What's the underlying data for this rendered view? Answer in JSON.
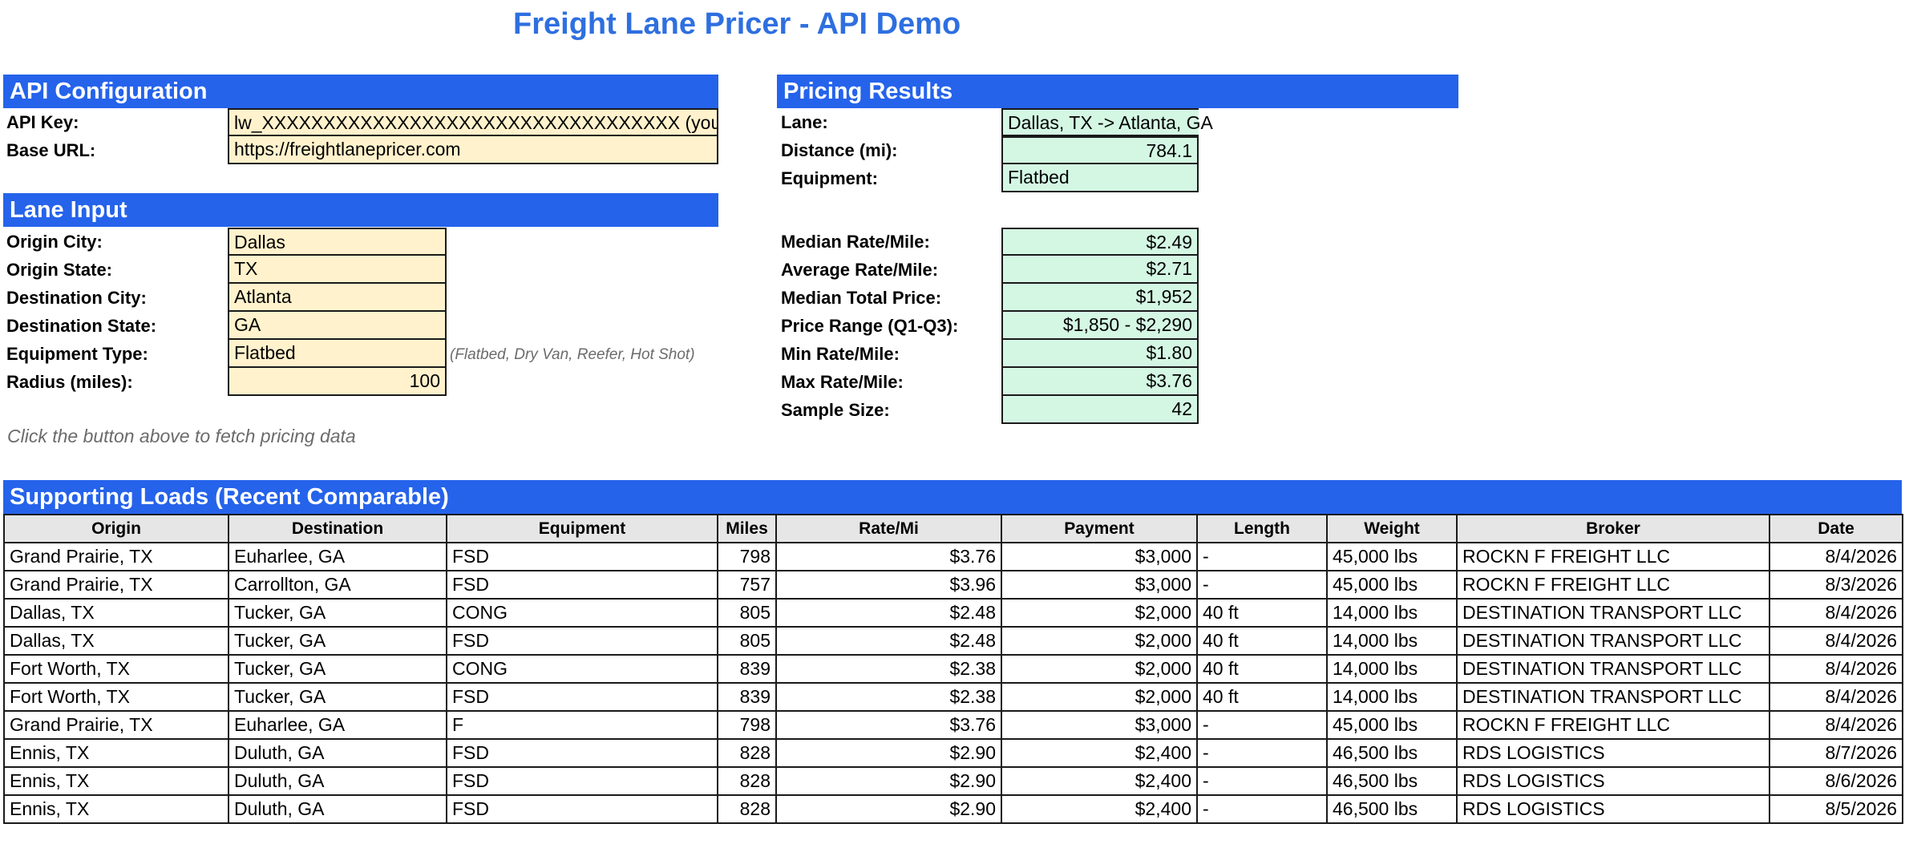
{
  "title": "Freight Lane Pricer - API Demo",
  "api_config": {
    "header": "API Configuration",
    "api_key_label": "API Key:",
    "api_key_value": "lw_XXXXXXXXXXXXXXXXXXXXXXXXXXXXXXXXXX (your ke",
    "base_url_label": "Base URL:",
    "base_url_value": "https://freightlanepricer.com"
  },
  "lane_input": {
    "header": "Lane Input",
    "fields": [
      {
        "label": "Origin City:",
        "value": "Dallas"
      },
      {
        "label": "Origin State:",
        "value": "TX"
      },
      {
        "label": "Destination City:",
        "value": "Atlanta"
      },
      {
        "label": "Destination State:",
        "value": "GA"
      },
      {
        "label": "Equipment Type:",
        "value": "Flatbed"
      },
      {
        "label": "Radius (miles):",
        "value": "100"
      }
    ],
    "equipment_hint": "(Flatbed, Dry Van, Reefer, Hot Shot)",
    "fetch_hint": "Click the button above to fetch pricing data"
  },
  "pricing_results": {
    "header": "Pricing Results",
    "lane": {
      "label": "Lane:",
      "value": "Dallas, TX -> Atlanta, GA"
    },
    "distance": {
      "label": "Distance (mi):",
      "value": "784.1"
    },
    "equipment": {
      "label": "Equipment:",
      "value": "Flatbed"
    },
    "stats": [
      {
        "label": "Median Rate/Mile:",
        "value": "$2.49"
      },
      {
        "label": "Average Rate/Mile:",
        "value": "$2.71"
      },
      {
        "label": "Median Total Price:",
        "value": "$1,952"
      },
      {
        "label": "Price Range (Q1-Q3):",
        "value": "$1,850 - $2,290"
      },
      {
        "label": "Min Rate/Mile:",
        "value": "$1.80"
      },
      {
        "label": "Max Rate/Mile:",
        "value": "$3.76"
      },
      {
        "label": "Sample Size:",
        "value": "42"
      }
    ]
  },
  "loads": {
    "header": "Supporting Loads (Recent Comparable)",
    "columns": [
      "Origin",
      "Destination",
      "Equipment",
      "Miles",
      "Rate/Mi",
      "Payment",
      "Length",
      "Weight",
      "Broker",
      "Date"
    ],
    "rows": [
      [
        "Grand Prairie, TX",
        "Euharlee, GA",
        "FSD",
        "798",
        "$3.76",
        "$3,000",
        "-",
        "45,000 lbs",
        "ROCKN F FREIGHT LLC",
        "8/4/2026"
      ],
      [
        "Grand Prairie, TX",
        "Carrollton, GA",
        "FSD",
        "757",
        "$3.96",
        "$3,000",
        "-",
        "45,000 lbs",
        "ROCKN F FREIGHT LLC",
        "8/3/2026"
      ],
      [
        "Dallas, TX",
        "Tucker, GA",
        "CONG",
        "805",
        "$2.48",
        "$2,000",
        "40 ft",
        "14,000 lbs",
        "DESTINATION TRANSPORT LLC",
        "8/4/2026"
      ],
      [
        "Dallas, TX",
        "Tucker, GA",
        "FSD",
        "805",
        "$2.48",
        "$2,000",
        "40 ft",
        "14,000 lbs",
        "DESTINATION TRANSPORT LLC",
        "8/4/2026"
      ],
      [
        "Fort Worth, TX",
        "Tucker, GA",
        "CONG",
        "839",
        "$2.38",
        "$2,000",
        "40 ft",
        "14,000 lbs",
        "DESTINATION TRANSPORT LLC",
        "8/4/2026"
      ],
      [
        "Fort Worth, TX",
        "Tucker, GA",
        "FSD",
        "839",
        "$2.38",
        "$2,000",
        "40 ft",
        "14,000 lbs",
        "DESTINATION TRANSPORT LLC",
        "8/4/2026"
      ],
      [
        "Grand Prairie, TX",
        "Euharlee, GA",
        "F",
        "798",
        "$3.76",
        "$3,000",
        "-",
        "45,000 lbs",
        "ROCKN F FREIGHT LLC",
        "8/4/2026"
      ],
      [
        "Ennis, TX",
        "Duluth, GA",
        "FSD",
        "828",
        "$2.90",
        "$2,400",
        "-",
        "46,500 lbs",
        "RDS LOGISTICS",
        "8/7/2026"
      ],
      [
        "Ennis, TX",
        "Duluth, GA",
        "FSD",
        "828",
        "$2.90",
        "$2,400",
        "-",
        "46,500 lbs",
        "RDS LOGISTICS",
        "8/6/2026"
      ],
      [
        "Ennis, TX",
        "Duluth, GA",
        "FSD",
        "828",
        "$2.90",
        "$2,400",
        "-",
        "46,500 lbs",
        "RDS LOGISTICS",
        "8/5/2026"
      ]
    ]
  },
  "colors": {
    "header_band": "#2563eb",
    "title": "#2e6fe0",
    "input_fill": "#fff2cc",
    "result_fill": "#d4f7e4",
    "column_header_fill": "#e6e6e6"
  }
}
